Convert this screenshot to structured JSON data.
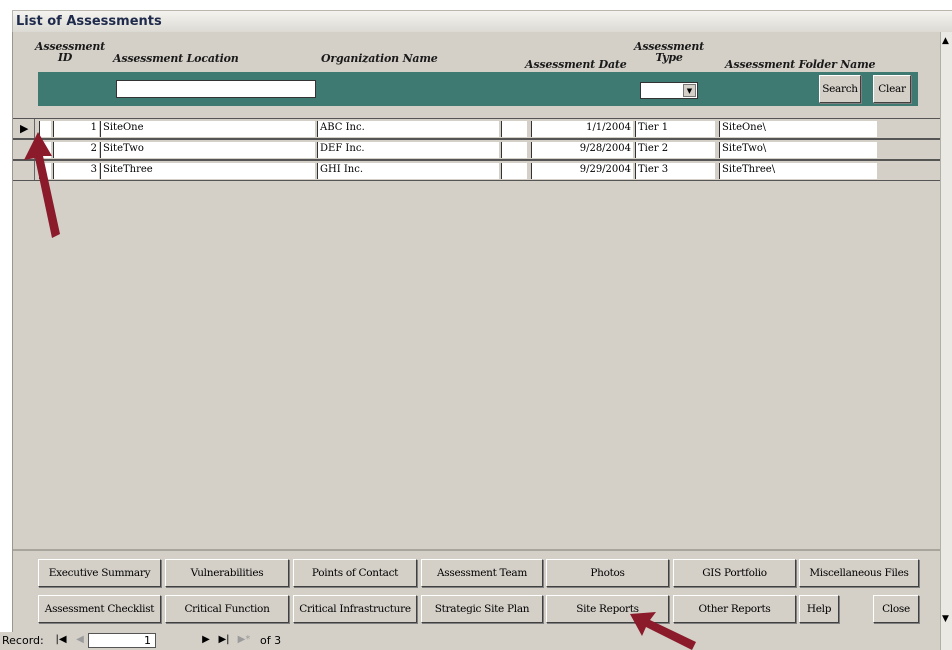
{
  "window": {
    "title": "List of Assessments"
  },
  "columns": {
    "id_line1": "Assessment",
    "id_line2": "ID",
    "location": "Assessment Location",
    "organization": "Organization Name",
    "date": "Assessment Date",
    "type_line1": "Assessment",
    "type_line2": "Type",
    "folder": "Assessment Folder Name"
  },
  "filter": {
    "location_value": "",
    "type_value": "",
    "search_label": "Search",
    "clear_label": "Clear"
  },
  "rows": [
    {
      "id": "1",
      "location": "SiteOne",
      "organization": "ABC Inc.",
      "date": "1/1/2004",
      "type": "Tier 1",
      "folder": "SiteOne\\"
    },
    {
      "id": "2",
      "location": "SiteTwo",
      "organization": "DEF Inc.",
      "date": "9/28/2004",
      "type": "Tier 2",
      "folder": "SiteTwo\\"
    },
    {
      "id": "3",
      "location": "SiteThree",
      "organization": "GHI Inc.",
      "date": "9/29/2004",
      "type": "Tier 3",
      "folder": "SiteThree\\"
    }
  ],
  "buttons_row1": {
    "executive_summary": "Executive Summary",
    "vulnerabilities": "Vulnerabilities",
    "points_of_contact": "Points of Contact",
    "assessment_team": "Assessment Team",
    "photos": "Photos",
    "gis_portfolio": "GIS Portfolio",
    "miscellaneous_files": "Miscellaneous Files"
  },
  "buttons_row2": {
    "assessment_checklist": "Assessment Checklist",
    "critical_function": "Critical Function",
    "critical_infrastructure": "Critical Infrastructure",
    "strategic_site_plan": "Strategic Site Plan",
    "site_reports": "Site Reports",
    "other_reports": "Other Reports",
    "help": "Help",
    "close": "Close"
  },
  "navigation": {
    "record_label": "Record:",
    "current": "1",
    "of_label": "of 3"
  },
  "icons": {
    "first": "first-record-icon",
    "prev": "previous-record-icon",
    "next": "next-record-icon",
    "last": "last-record-icon",
    "new": "new-record-icon"
  },
  "colors": {
    "filter_bar": "#3f7a72",
    "annotation_arrow": "#8b1a2b",
    "form_background": "#d4d0c8"
  }
}
